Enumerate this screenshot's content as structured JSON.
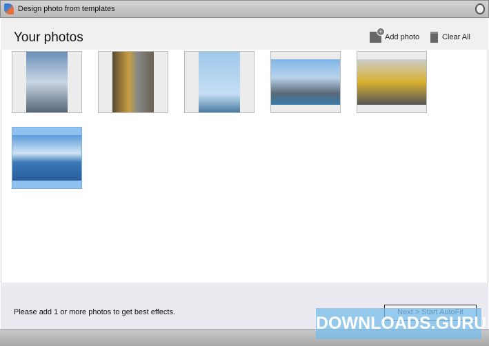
{
  "window": {
    "title": "Design photo from templates"
  },
  "header": {
    "title": "Your photos",
    "add_photo": "Add photo",
    "clear_all": "Clear All"
  },
  "photos": [
    {
      "subject": "sculpture",
      "selected": false
    },
    {
      "subject": "street-signs",
      "selected": false
    },
    {
      "subject": "statue-of-liberty",
      "selected": false
    },
    {
      "subject": "city-skyline",
      "selected": false
    },
    {
      "subject": "yellow-taxis",
      "selected": false
    },
    {
      "subject": "mountain-lake",
      "selected": true
    }
  ],
  "footer": {
    "hint": "Please add 1 or more photos to get best effects.",
    "next_button": "Next >  Start AutoFit"
  },
  "watermark": "DOWNLOADS.GURU"
}
